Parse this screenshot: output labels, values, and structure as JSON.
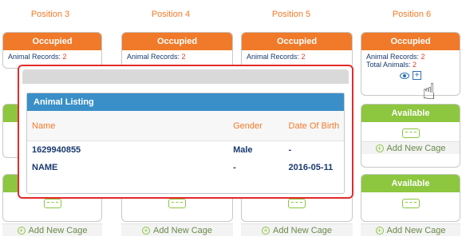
{
  "positions": [
    "Position 3",
    "Position 4",
    "Position 5",
    "Position 6"
  ],
  "status": {
    "occupied": "Occupied",
    "available": "Available"
  },
  "card": {
    "animal_records_label": "Animal Records:",
    "animal_records_value": "2",
    "total_animals_label": "Total Animals:",
    "total_animals_value": "2"
  },
  "add_cage_label": "Add New Cage",
  "popup": {
    "title": "Animal Listing",
    "columns": [
      "Name",
      "Gender",
      "Date Of Birth"
    ],
    "rows": [
      [
        "1629940855",
        "Male",
        "-"
      ],
      [
        "NAME",
        "-",
        "2016-05-11"
      ]
    ]
  },
  "colors": {
    "orange": "#f07a2a",
    "green": "#8dc63f",
    "blue": "#3a8fc8",
    "highlight": "#e32b2b"
  }
}
